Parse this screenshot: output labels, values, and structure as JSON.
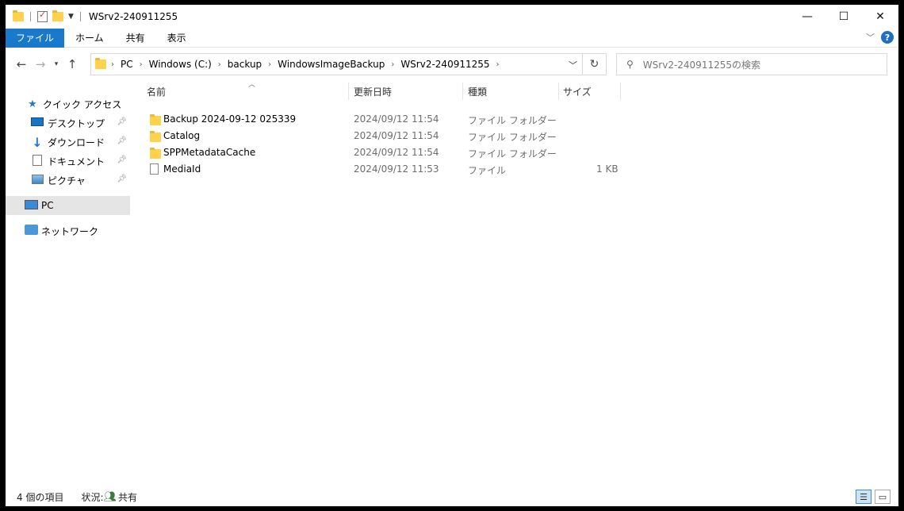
{
  "window": {
    "title": "WSrv2-240911255"
  },
  "ribbon": {
    "tabs": [
      "ファイル",
      "ホーム",
      "共有",
      "表示"
    ]
  },
  "address": {
    "crumbs": [
      "PC",
      "Windows (C:)",
      "backup",
      "WindowsImageBackup",
      "WSrv2-240911255"
    ]
  },
  "search": {
    "placeholder": "WSrv2-240911255の検索"
  },
  "nav": {
    "quick_access": "クイック アクセス",
    "items": [
      "デスクトップ",
      "ダウンロード",
      "ドキュメント",
      "ピクチャ"
    ],
    "pc": "PC",
    "network": "ネットワーク"
  },
  "list": {
    "columns": {
      "name": "名前",
      "date": "更新日時",
      "type": "種類",
      "size": "サイズ"
    },
    "rows": [
      {
        "name": "Backup 2024-09-12 025339",
        "date": "2024/09/12 11:54",
        "type": "ファイル フォルダー",
        "size": ""
      },
      {
        "name": "Catalog",
        "date": "2024/09/12 11:54",
        "type": "ファイル フォルダー",
        "size": ""
      },
      {
        "name": "SPPMetadataCache",
        "date": "2024/09/12 11:54",
        "type": "ファイル フォルダー",
        "size": ""
      },
      {
        "name": "MediaId",
        "date": "2024/09/12 11:53",
        "type": "ファイル",
        "size": "1 KB"
      }
    ]
  },
  "status": {
    "count": "4 個の項目",
    "state_label": "状況:",
    "state_value": "共有"
  }
}
